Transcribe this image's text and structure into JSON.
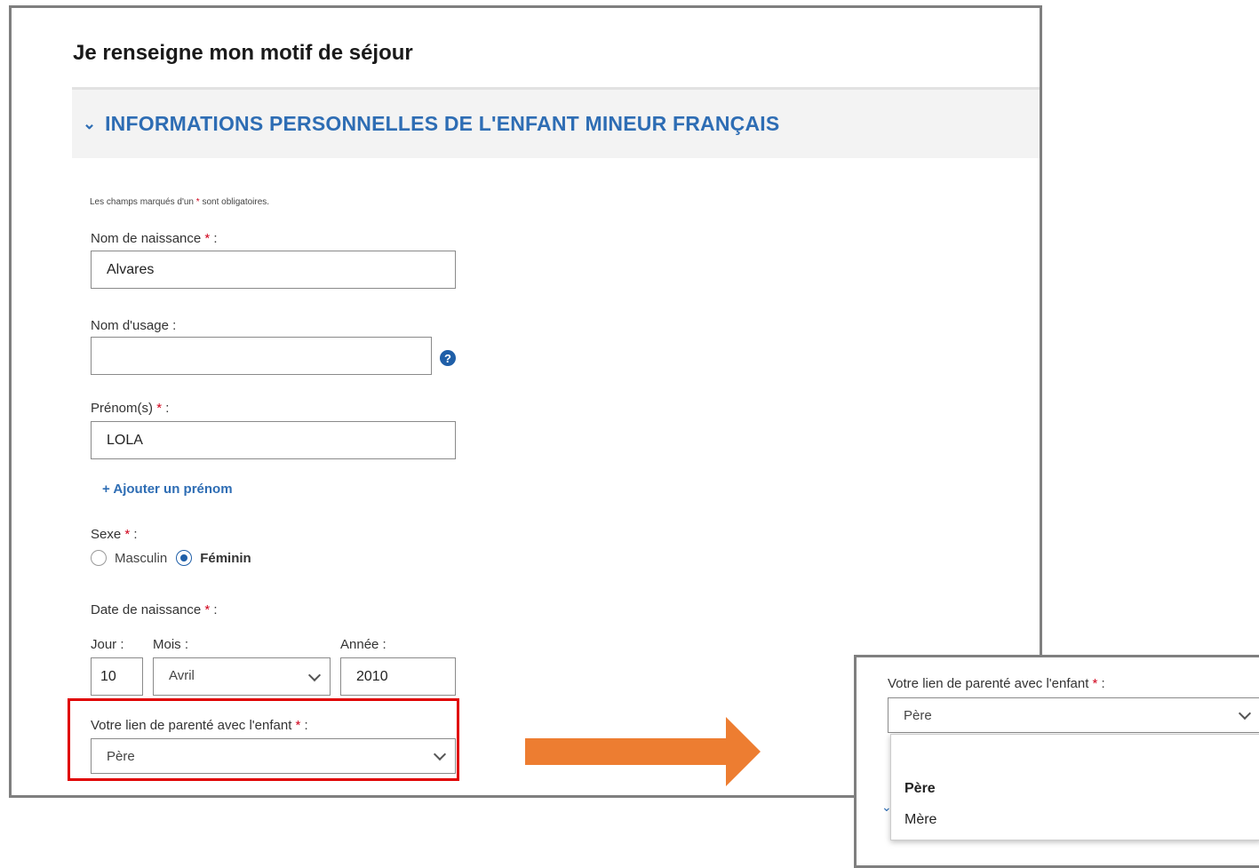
{
  "page_title": "Je renseigne mon motif de séjour",
  "section": {
    "title": "INFORMATIONS PERSONNELLES DE L'ENFANT MINEUR FRANÇAIS",
    "chevron_icon": "chevron-down-icon"
  },
  "required_note": {
    "prefix": "Les champs marqués d'un ",
    "star": "*",
    "suffix": " sont obligatoires."
  },
  "fields": {
    "nom_naissance": {
      "label": "Nom de naissance ",
      "star": "*",
      "colon": " :",
      "value": "Alvares"
    },
    "nom_usage": {
      "label": "Nom d'usage :",
      "value": "",
      "help_icon": "question-circle-icon",
      "help_glyph": "?"
    },
    "prenoms": {
      "label": "Prénom(s) ",
      "star": "*",
      "colon": " :",
      "value": "LOLA"
    },
    "add_prenom": "+ Ajouter un prénom",
    "sexe": {
      "label": "Sexe ",
      "star": "*",
      "colon": " :",
      "options": [
        "Masculin",
        "Féminin"
      ],
      "selected": "Féminin"
    },
    "date_naissance": {
      "label": "Date de naissance ",
      "star": "*",
      "colon": " :",
      "jour_label": "Jour :",
      "mois_label": "Mois :",
      "annee_label": "Année :",
      "jour": "10",
      "mois": "Avril",
      "annee": "2010"
    },
    "lien_parente": {
      "label": "Votre lien de parenté avec l'enfant ",
      "star": "*",
      "colon": " :",
      "value": "Père"
    }
  },
  "zoom": {
    "label": "Votre lien de parenté avec l'enfant ",
    "star": "*",
    "colon": " :",
    "value": "Père",
    "options": [
      "",
      "Père",
      "Mère"
    ],
    "selected": "Père"
  },
  "colors": {
    "accent": "#2e6db4",
    "required": "#d0021b",
    "highlight": "#e00000",
    "arrow": "#ed7d31"
  }
}
